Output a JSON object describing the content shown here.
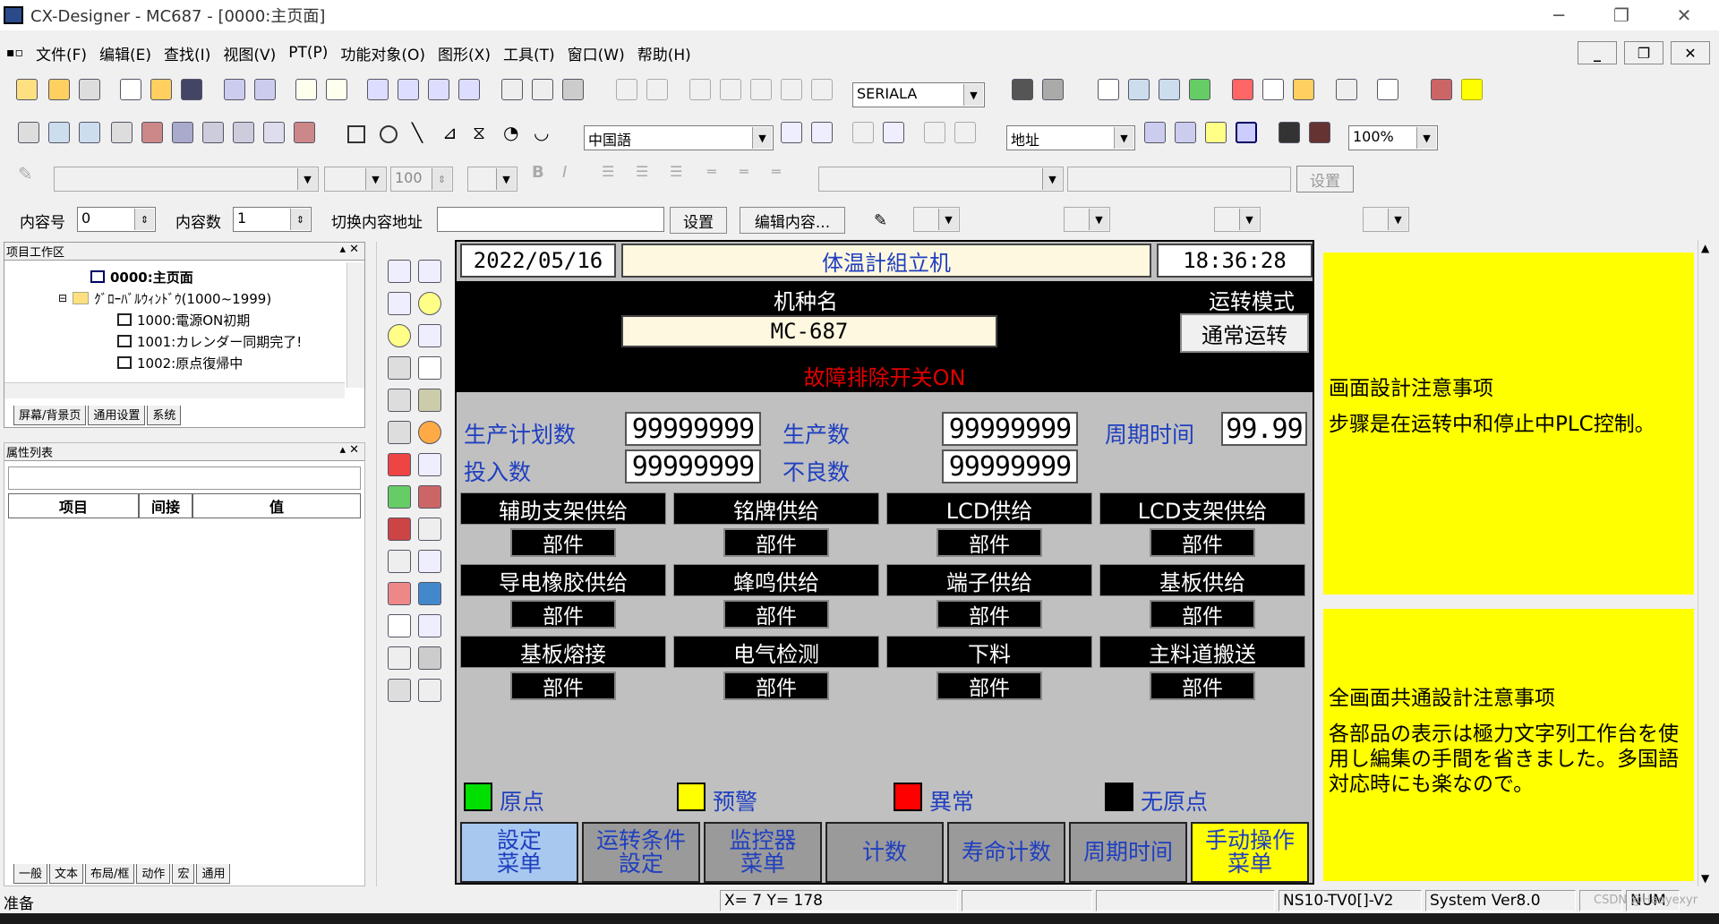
{
  "window": {
    "title": "CX-Designer - MC687 - [0000:主页面]"
  },
  "menu": [
    "文件(F)",
    "编辑(E)",
    "查找(I)",
    "视图(V)",
    "PT(P)",
    "功能对象(O)",
    "图形(X)",
    "工具(T)",
    "窗口(W)",
    "帮助(H)"
  ],
  "toolbar1": {
    "port_select": "SERIALA"
  },
  "toolbar2": {
    "language_select": "中国語",
    "address_select": "地址",
    "zoom_select": "100%"
  },
  "toolbar3": {
    "font_size": "100",
    "set_button": "设置"
  },
  "toolbar4": {
    "content_no_label": "内容号",
    "content_no_value": "0",
    "content_count_label": "内容数",
    "content_count_value": "1",
    "switch_addr_label": "切换内容地址",
    "set_button": "设置",
    "edit_content_button": "编辑内容..."
  },
  "project_panel": {
    "title": "项目工作区",
    "tree": [
      {
        "label": "0000:主页面",
        "bold": true
      },
      {
        "label": "ｸﾞﾛｰﾊﾞﾙｳｨﾝﾄﾞｳ(1000~1999)",
        "folder": true
      },
      {
        "label": "1000:電源ON初期"
      },
      {
        "label": "1001:カレンダー同期完了!"
      },
      {
        "label": "1002:原点復帰中"
      }
    ],
    "tabs": [
      "屏幕/背景页",
      "通用设置",
      "系统"
    ]
  },
  "property_panel": {
    "title": "属性列表",
    "columns": [
      "项目",
      "间接",
      "值"
    ],
    "tabs": [
      "一般",
      "文本",
      "布局/框",
      "动作",
      "宏",
      "通用"
    ]
  },
  "hmi": {
    "date": "2022/05/16",
    "header_title": "体温計組立机",
    "time": "18:36:28",
    "model_label": "机种名",
    "model_value": "MC-687",
    "mode_label": "运转模式",
    "mode_value": "通常运转",
    "fault_text": "故障排除开关ON",
    "counters": [
      {
        "label": "生产计划数",
        "value": "99999999"
      },
      {
        "label": "生产数",
        "value": "99999999"
      },
      {
        "label": "周期时间",
        "value": "99.99"
      },
      {
        "label": "投入数",
        "value": "99999999"
      },
      {
        "label": "不良数",
        "value": "99999999"
      }
    ],
    "stations": [
      {
        "name": "辅助支架供给",
        "part": "部件"
      },
      {
        "name": "铭牌供给",
        "part": "部件"
      },
      {
        "name": "LCD供给",
        "part": "部件"
      },
      {
        "name": "LCD支架供给",
        "part": "部件"
      },
      {
        "name": "导电橡胶供给",
        "part": "部件"
      },
      {
        "name": "蜂鸣供给",
        "part": "部件"
      },
      {
        "name": "端子供给",
        "part": "部件"
      },
      {
        "name": "基板供给",
        "part": "部件"
      },
      {
        "name": "基板熔接",
        "part": "部件"
      },
      {
        "name": "电气检测",
        "part": "部件"
      },
      {
        "name": "下料",
        "part": "部件"
      },
      {
        "name": "主料道搬送",
        "part": "部件"
      }
    ],
    "legend": [
      {
        "label": "原点",
        "color": "#00e000"
      },
      {
        "label": "预警",
        "color": "#ffff00"
      },
      {
        "label": "異常",
        "color": "#ff0000"
      },
      {
        "label": "无原点",
        "color": "#000000"
      }
    ],
    "nav": [
      {
        "label": "設定\n菜单",
        "bg": "#a8c8f0"
      },
      {
        "label": "运转条件\n設定",
        "bg": "#9a9a9a"
      },
      {
        "label": "监控器\n菜单",
        "bg": "#9a9a9a"
      },
      {
        "label": "计数",
        "bg": "#9a9a9a"
      },
      {
        "label": "寿命计数",
        "bg": "#9a9a9a"
      },
      {
        "label": "周期时间",
        "bg": "#9a9a9a"
      },
      {
        "label": "手动操作\n菜单",
        "bg": "#ffff00"
      }
    ]
  },
  "notes": {
    "note1_title": "画面設計注意事项",
    "note1_text": "步骤是在运转中和停止中PLC控制。",
    "note2_title": "全画面共通設計注意事项",
    "note2_text": "各部品の表示は極力文字列工作台を使用し編集の手間を省きました。多国語対応時にも楽なので。"
  },
  "status": {
    "ready": "准备",
    "coords": "X=  7 Y= 178",
    "model": "NS10-TV0[]-V2",
    "version": "System Ver8.0",
    "num": "NUM",
    "watermark": "CSDN @Haoyexyr"
  }
}
